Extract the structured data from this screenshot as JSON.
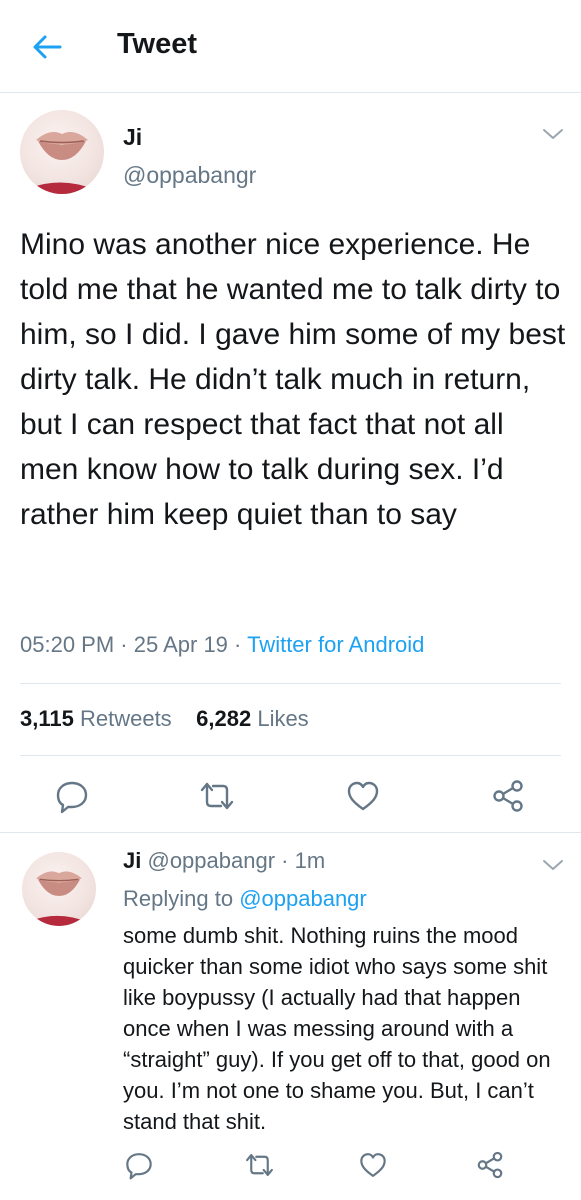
{
  "header": {
    "title": "Tweet",
    "back_icon": "arrow-left-icon"
  },
  "colors": {
    "accent": "#1da1f2",
    "muted": "#657786",
    "text": "#14171a",
    "divider": "#e1e8ed"
  },
  "tweet": {
    "name": "Ji",
    "handle": "@oppabangr",
    "text": "Mino was another nice experience. He told me that he wanted me to talk dirty to him, so I did. I gave him some of my best dirty talk. He didn’t talk much in return, but I can respect that fact that not all men know how to talk during sex. I’d rather him keep quiet than to say",
    "time": "05:20 PM",
    "date": "25 Apr 19",
    "source": "Twitter for Android",
    "retweets": "3,115",
    "retweets_label": "Retweets",
    "likes": "6,282",
    "likes_label": "Likes"
  },
  "reply": {
    "name": "Ji",
    "handle": "@oppabangr",
    "time": "1m",
    "replying_label": "Replying to",
    "replying_to": "@oppabangr",
    "text": "some dumb shit. Nothing ruins the mood quicker than some idiot who says some shit like boypussy (I actually had that happen once when I was messing around with a “straight” guy). If you get off to that, good on you. I’m not one to shame you. But, I can’t stand that shit."
  },
  "actions": [
    "reply-icon",
    "retweet-icon",
    "like-icon",
    "share-icon"
  ]
}
